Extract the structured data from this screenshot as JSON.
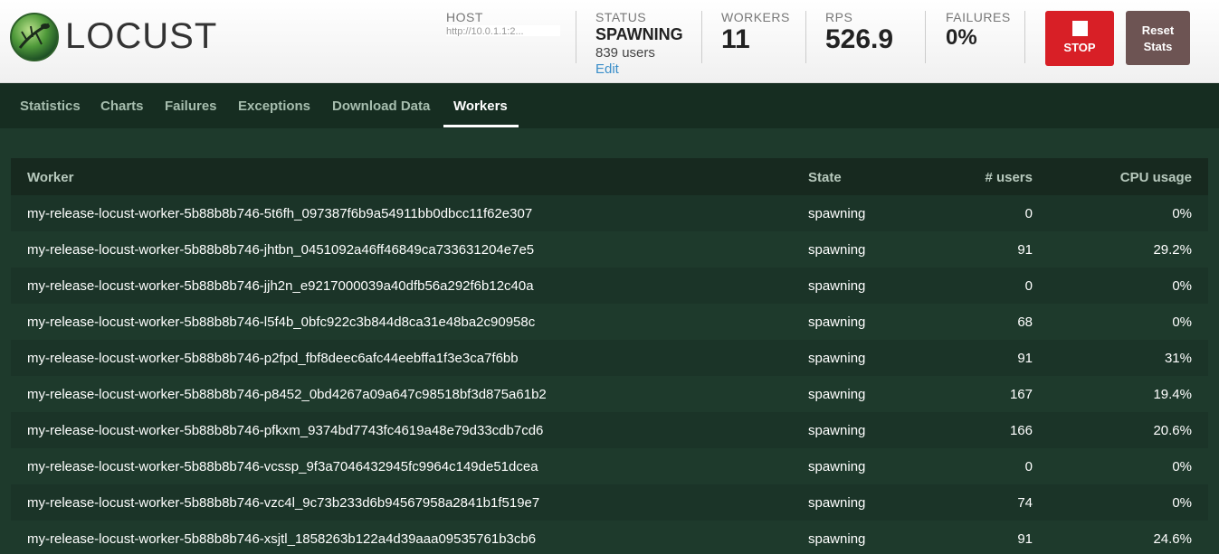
{
  "app": {
    "name": "LOCUST"
  },
  "header": {
    "host_label": "HOST",
    "host_value": "http://10.0.1.1:2...",
    "status_label": "STATUS",
    "status_value": "SPAWNING",
    "status_users": "839 users",
    "status_edit": "Edit",
    "workers_label": "WORKERS",
    "workers_value": "11",
    "rps_label": "RPS",
    "rps_value": "526.9",
    "failures_label": "FAILURES",
    "failures_value": "0%",
    "stop_label": "STOP",
    "reset_label_line1": "Reset",
    "reset_label_line2": "Stats"
  },
  "colors": {
    "stop": "#d81f26",
    "reset": "#6d5453",
    "accent_link": "#3a8ec9",
    "bg": "#1e3a2c"
  },
  "tabs": [
    {
      "label": "Statistics",
      "active": false
    },
    {
      "label": "Charts",
      "active": false
    },
    {
      "label": "Failures",
      "active": false
    },
    {
      "label": "Exceptions",
      "active": false
    },
    {
      "label": "Download Data",
      "active": false
    },
    {
      "label": "Workers",
      "active": true
    }
  ],
  "table": {
    "columns": [
      "Worker",
      "State",
      "# users",
      "CPU usage"
    ],
    "rows": [
      {
        "worker": "my-release-locust-worker-5b88b8b746-5t6fh_097387f6b9a54911bb0dbcc11f62e307",
        "state": "spawning",
        "users": "0",
        "cpu": "0%"
      },
      {
        "worker": "my-release-locust-worker-5b88b8b746-jhtbn_0451092a46ff46849ca733631204e7e5",
        "state": "spawning",
        "users": "91",
        "cpu": "29.2%"
      },
      {
        "worker": "my-release-locust-worker-5b88b8b746-jjh2n_e9217000039a40dfb56a292f6b12c40a",
        "state": "spawning",
        "users": "0",
        "cpu": "0%"
      },
      {
        "worker": "my-release-locust-worker-5b88b8b746-l5f4b_0bfc922c3b844d8ca31e48ba2c90958c",
        "state": "spawning",
        "users": "68",
        "cpu": "0%"
      },
      {
        "worker": "my-release-locust-worker-5b88b8b746-p2fpd_fbf8deec6afc44eebffa1f3e3ca7f6bb",
        "state": "spawning",
        "users": "91",
        "cpu": "31%"
      },
      {
        "worker": "my-release-locust-worker-5b88b8b746-p8452_0bd4267a09a647c98518bf3d875a61b2",
        "state": "spawning",
        "users": "167",
        "cpu": "19.4%"
      },
      {
        "worker": "my-release-locust-worker-5b88b8b746-pfkxm_9374bd7743fc4619a48e79d33cdb7cd6",
        "state": "spawning",
        "users": "166",
        "cpu": "20.6%"
      },
      {
        "worker": "my-release-locust-worker-5b88b8b746-vcssp_9f3a7046432945fc9964c149de51dcea",
        "state": "spawning",
        "users": "0",
        "cpu": "0%"
      },
      {
        "worker": "my-release-locust-worker-5b88b8b746-vzc4l_9c73b233d6b94567958a2841b1f519e7",
        "state": "spawning",
        "users": "74",
        "cpu": "0%"
      },
      {
        "worker": "my-release-locust-worker-5b88b8b746-xsjtl_1858263b122a4d39aaa09535761b3cb6",
        "state": "spawning",
        "users": "91",
        "cpu": "24.6%"
      }
    ]
  }
}
